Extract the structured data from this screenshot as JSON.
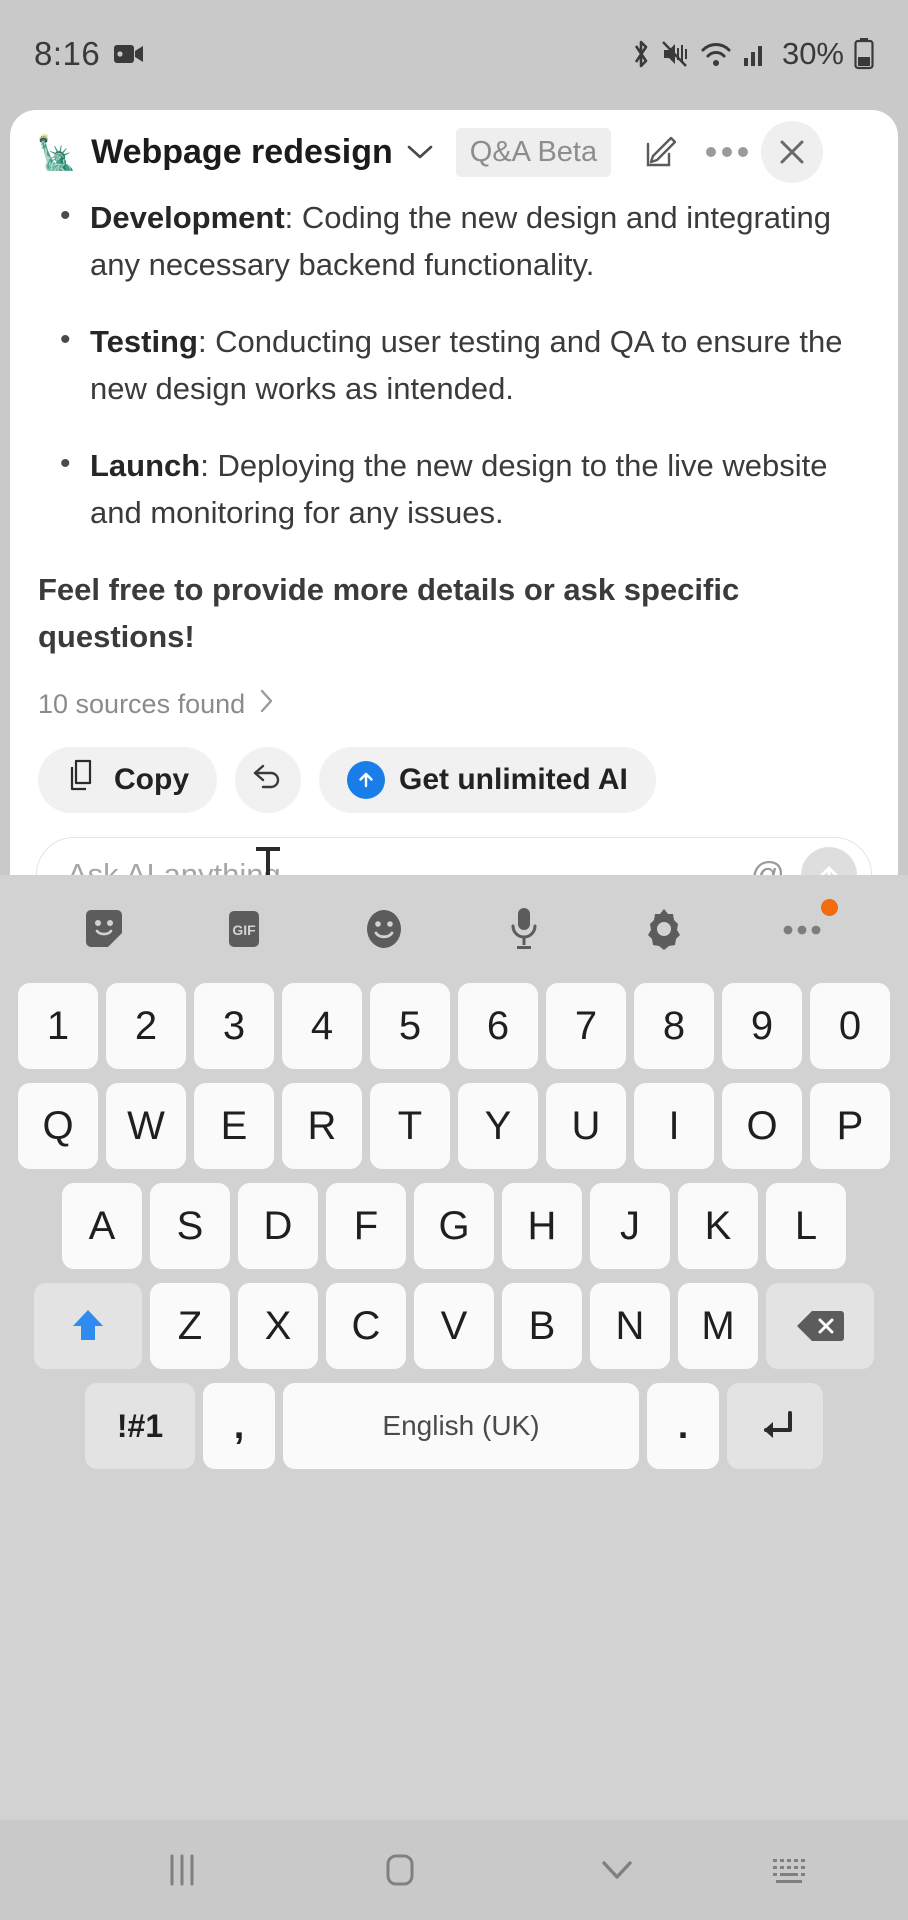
{
  "status_bar": {
    "time": "8:16",
    "battery_percent": "30%",
    "icons": [
      "video-recording-icon",
      "bluetooth-icon",
      "mute-vibrate-icon",
      "wifi-icon",
      "cellular-signal-icon",
      "battery-icon"
    ]
  },
  "app": {
    "emoji": "🗽",
    "title": "Webpage redesign",
    "badge": "Q&A Beta",
    "header_icons": [
      "chevron-down-icon",
      "edit-note-icon",
      "more-options-icon",
      "close-icon"
    ]
  },
  "conversation": {
    "bullets": [
      {
        "label": "Development",
        "text": ": Coding the new design and integrating any necessary backend functionality."
      },
      {
        "label": "Testing",
        "text": ": Conducting user testing and QA to ensure the new design works as intended."
      },
      {
        "label": "Launch",
        "text": ": Deploying the new design to the live website and monitoring for any issues."
      }
    ],
    "closing": "Feel free to provide more details or ask specific questions!",
    "sources_label": "10 sources found"
  },
  "actions": {
    "copy": "Copy",
    "regenerate": "",
    "upgrade": "Get unlimited AI"
  },
  "input": {
    "placeholder": "Ask AI anything...",
    "value": "",
    "at_symbol": "@"
  },
  "keyboard": {
    "toolbar": [
      "sticker-icon",
      "gif-icon",
      "emoji-icon",
      "microphone-icon",
      "settings-gear-icon",
      "more-options-icon"
    ],
    "row_numbers": [
      "1",
      "2",
      "3",
      "4",
      "5",
      "6",
      "7",
      "8",
      "9",
      "0"
    ],
    "row_top": [
      "Q",
      "W",
      "E",
      "R",
      "T",
      "Y",
      "U",
      "I",
      "O",
      "P"
    ],
    "row_home": [
      "A",
      "S",
      "D",
      "F",
      "G",
      "H",
      "J",
      "K",
      "L"
    ],
    "row_bottom": [
      "Z",
      "X",
      "C",
      "V",
      "B",
      "N",
      "M"
    ],
    "shift": "shift-icon",
    "backspace": "backspace-icon",
    "symbols": "!#1",
    "comma": ",",
    "space": "English (UK)",
    "period": ".",
    "enter": "enter-icon"
  },
  "navigation": {
    "recents": "recents-icon",
    "home": "home-icon",
    "back": "back-chevron-icon",
    "keyboard_toggle": "hide-keyboard-icon"
  },
  "colors": {
    "accent_blue": "#1a7ee8",
    "shift_blue": "#2e8cf0",
    "badge_orange": "#f26b0f",
    "panel_bg": "#ffffff",
    "keyboard_bg": "#d2d2d2"
  }
}
